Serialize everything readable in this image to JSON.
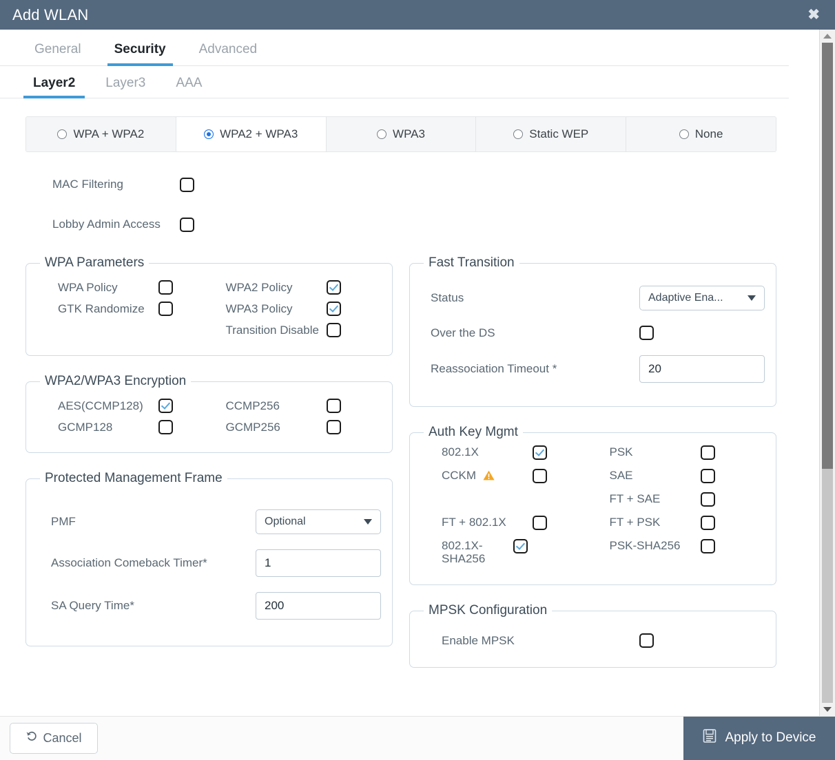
{
  "dialog": {
    "title": "Add WLAN",
    "close_icon": "close-icon"
  },
  "tabs_primary": [
    {
      "label": "General",
      "active": false
    },
    {
      "label": "Security",
      "active": true
    },
    {
      "label": "Advanced",
      "active": false
    }
  ],
  "tabs_secondary": [
    {
      "label": "Layer2",
      "active": true
    },
    {
      "label": "Layer3",
      "active": false
    },
    {
      "label": "AAA",
      "active": false
    }
  ],
  "security_modes": [
    {
      "label": "WPA + WPA2",
      "selected": false
    },
    {
      "label": "WPA2 + WPA3",
      "selected": true
    },
    {
      "label": "WPA3",
      "selected": false
    },
    {
      "label": "Static WEP",
      "selected": false
    },
    {
      "label": "None",
      "selected": false
    }
  ],
  "top_options": [
    {
      "label": "MAC Filtering",
      "checked": false
    },
    {
      "label": "Lobby Admin Access",
      "checked": false
    }
  ],
  "wpa_parameters": {
    "legend": "WPA Parameters",
    "left": [
      {
        "label": "WPA Policy",
        "checked": false
      },
      {
        "label": "GTK Randomize",
        "checked": false
      }
    ],
    "right": [
      {
        "label": "WPA2 Policy",
        "checked": true
      },
      {
        "label": "WPA3 Policy",
        "checked": true
      },
      {
        "label": "Transition Disable",
        "checked": false
      }
    ]
  },
  "encryption": {
    "legend": "WPA2/WPA3 Encryption",
    "left": [
      {
        "label": "AES(CCMP128)",
        "checked": true
      },
      {
        "label": "GCMP128",
        "checked": false
      }
    ],
    "right": [
      {
        "label": "CCMP256",
        "checked": false
      },
      {
        "label": "GCMP256",
        "checked": false
      }
    ]
  },
  "pmf": {
    "legend": "Protected Management Frame",
    "pmf_label": "PMF",
    "pmf_value": "Optional",
    "comeback_label": "Association Comeback Timer*",
    "comeback_value": "1",
    "saquery_label": "SA Query Time*",
    "saquery_value": "200"
  },
  "fast_transition": {
    "legend": "Fast Transition",
    "status_label": "Status",
    "status_value": "Adaptive Ena...",
    "overds_label": "Over the DS",
    "overds_checked": false,
    "reassoc_label": "Reassociation Timeout *",
    "reassoc_value": "20"
  },
  "auth_key_mgmt": {
    "legend": "Auth Key Mgmt",
    "left": [
      {
        "label": "802.1X",
        "checked": true,
        "warn": false
      },
      {
        "label": "CCKM",
        "checked": false,
        "warn": true
      },
      {
        "label": "",
        "checked": null,
        "warn": false
      },
      {
        "label": "FT + 802.1X",
        "checked": false,
        "warn": false
      },
      {
        "label": "802.1X-SHA256",
        "checked": true,
        "warn": false
      }
    ],
    "right": [
      {
        "label": "PSK",
        "checked": false,
        "warn": false
      },
      {
        "label": "SAE",
        "checked": false,
        "warn": false
      },
      {
        "label": "FT + SAE",
        "checked": false,
        "warn": false
      },
      {
        "label": "FT + PSK",
        "checked": false,
        "warn": false
      },
      {
        "label": "PSK-SHA256",
        "checked": false,
        "warn": false
      }
    ]
  },
  "mpsk": {
    "legend": "MPSK Configuration",
    "enable_label": "Enable MPSK",
    "enable_checked": false
  },
  "footer": {
    "cancel_label": "Cancel",
    "apply_label": "Apply to Device"
  },
  "colors": {
    "header": "#54687e",
    "accent": "#3f9bd8",
    "radio_selected": "#1a73e8",
    "check_mark": "#59a7dd",
    "group_border": "#cfdbe6",
    "warning": "#f5a623",
    "label_text": "#5a6873"
  }
}
